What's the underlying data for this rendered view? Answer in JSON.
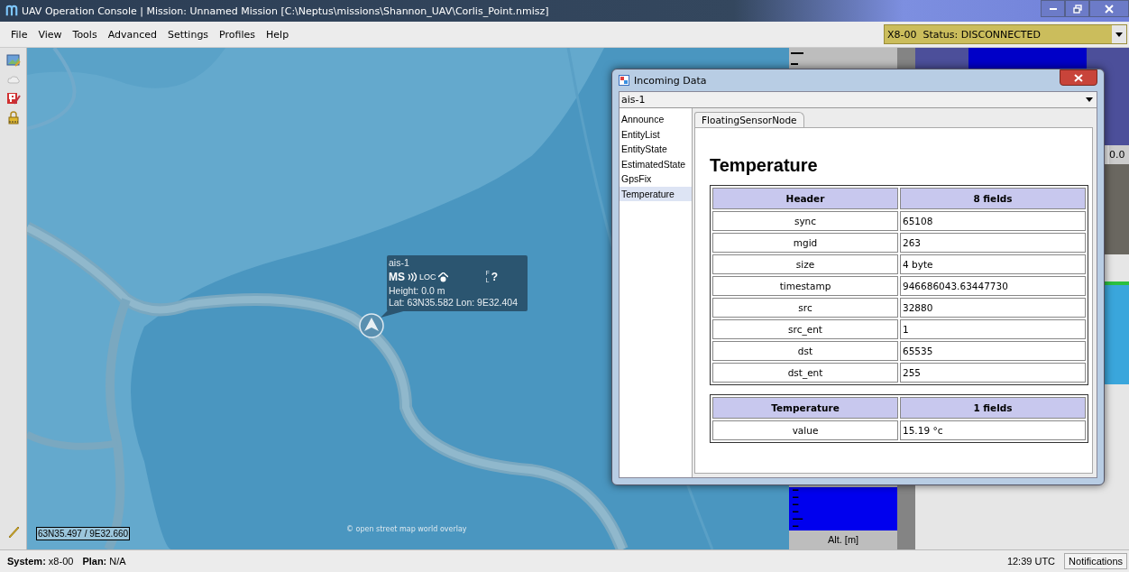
{
  "window": {
    "title": "UAV Operation Console | Mission: Unnamed Mission [C:\\Neptus\\missions\\Shannon_UAV\\Corlis_Point.nmisz]"
  },
  "menu": [
    "File",
    "View",
    "Tools",
    "Advanced",
    "Settings",
    "Profiles",
    "Help"
  ],
  "vehicle_selector": {
    "value": "X8-00  Status: DISCONNECTED"
  },
  "map": {
    "marker": {
      "name": "ais-1",
      "indicators": [
        "MS",
        "LOC"
      ],
      "flags": [
        "F",
        "L",
        "?"
      ],
      "height": "Height: 0.0 m",
      "position": "Lat: 63N35.582 Lon: 9E32.404"
    },
    "cursor_position": "63N35.497 / 9E32.660",
    "attribution": "© open street map world overlay"
  },
  "instruments": {
    "reading": "0.0",
    "altitude_label": "Alt. [m]"
  },
  "dialog": {
    "title": "Incoming Data",
    "source": "ais-1",
    "messages": [
      {
        "label": "Announce",
        "selected": false
      },
      {
        "label": "EntityList",
        "selected": false
      },
      {
        "label": "EntityState",
        "selected": false
      },
      {
        "label": "EstimatedState",
        "selected": false
      },
      {
        "label": "GpsFix",
        "selected": false
      },
      {
        "label": "Temperature",
        "selected": true
      }
    ],
    "tabs": [
      {
        "label": "FloatingSensorNode",
        "selected": true
      }
    ],
    "heading": "Temperature",
    "tables": [
      {
        "columns": [
          "Header",
          "8 fields"
        ],
        "rows": [
          [
            "sync",
            "65108"
          ],
          [
            "mgid",
            "263"
          ],
          [
            "size",
            "4 byte"
          ],
          [
            "timestamp",
            "946686043.63447730"
          ],
          [
            "src",
            "32880"
          ],
          [
            "src_ent",
            "1"
          ],
          [
            "dst",
            "65535"
          ],
          [
            "dst_ent",
            "255"
          ]
        ]
      },
      {
        "columns": [
          "Temperature",
          "1 fields"
        ],
        "rows": [
          [
            "value",
            "15.19 °c"
          ]
        ]
      }
    ]
  },
  "status_bar": {
    "system": "**System:** x8-00",
    "plan": "**Plan:** N/A",
    "time": "12:39 UTC",
    "button": "Notifications"
  }
}
